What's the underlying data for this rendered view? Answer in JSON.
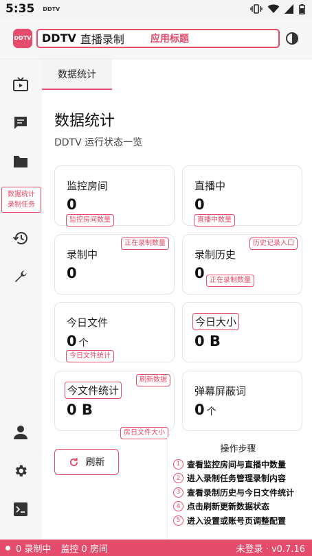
{
  "statusbar": {
    "time": "5:35",
    "carrier": "DDTV"
  },
  "app": {
    "logo": "DDTV",
    "title_main": "DDTV",
    "title_sub": "直播录制",
    "title_note": "应用标题"
  },
  "sidebar": {
    "active_line1": "数据统计",
    "active_line2": "录制任务"
  },
  "tab": {
    "label": "数据统计"
  },
  "page": {
    "title": "数据统计",
    "subtitle": "DDTV 运行状态一览"
  },
  "cards": {
    "monitor": {
      "label": "监控房间",
      "value": "0",
      "tag": "监控房间数量"
    },
    "live": {
      "label": "直播中",
      "value": "0",
      "tag": "直播中数量"
    },
    "recording": {
      "label": "录制中",
      "value": "0",
      "tag": "正在录制数量"
    },
    "history": {
      "label": "录制历史",
      "value": "0",
      "tag_top": "历史记录入口",
      "tag_bottom": "正在录制数量"
    },
    "today_files": {
      "label": "今日文件",
      "value": "0",
      "unit": "个",
      "tag": "今日文件统计"
    },
    "today_size": {
      "label": "今日大小",
      "value": "0 B"
    },
    "file_stats": {
      "label": "今文件统计",
      "value": "0 B",
      "tag_top": "刷新数据",
      "tag_bottom": "房日文件大小"
    },
    "danmaku": {
      "label": "弹幕屏蔽词",
      "value": "0",
      "unit": "个"
    }
  },
  "refresh": {
    "label": "刷新"
  },
  "steps": {
    "title": "操作步骤",
    "items": [
      {
        "num": "1",
        "text": "查看监控房间与直播中数量"
      },
      {
        "num": "2",
        "text": "进入录制任务管理录制内容"
      },
      {
        "num": "3",
        "text": "查看录制历史与今日文件统计"
      },
      {
        "num": "4",
        "text": "点击刷新更新数据状态"
      },
      {
        "num": "5",
        "text": "进入设置或账号页调整配置"
      }
    ]
  },
  "footer": {
    "recording": "0 录制中",
    "monitoring": "监控 0 房间",
    "status": "未登录 · v0.7.16"
  },
  "colors": {
    "accent": "#e54b6a"
  }
}
